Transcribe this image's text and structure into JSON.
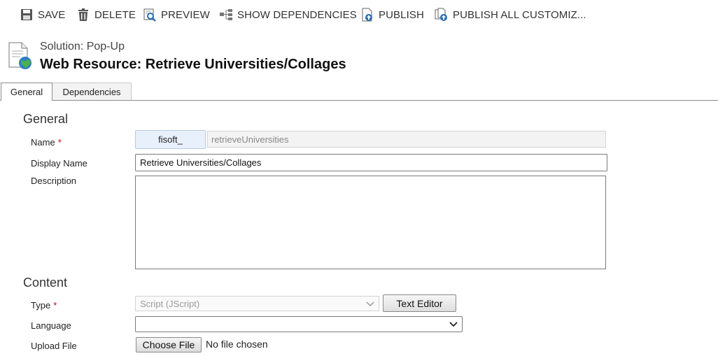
{
  "toolbar": {
    "save": "SAVE",
    "delete": "DELETE",
    "preview": "PREVIEW",
    "show_dependencies": "SHOW DEPENDENCIES",
    "publish": "PUBLISH",
    "publish_all": "PUBLISH ALL CUSTOMIZ..."
  },
  "header": {
    "solution": "Solution: Pop-Up",
    "title": "Web Resource: Retrieve Universities/Collages"
  },
  "tabs": [
    {
      "label": "General",
      "active": true
    },
    {
      "label": "Dependencies",
      "active": false
    }
  ],
  "general": {
    "section_title": "General",
    "name_label": "Name",
    "name_prefix": "fisoft_",
    "name_value": "retrieveUniversities",
    "display_name_label": "Display Name",
    "display_name_value": "Retrieve Universities/Collages",
    "description_label": "Description",
    "description_value": ""
  },
  "content": {
    "section_title": "Content",
    "type_label": "Type",
    "type_value": "Script (JScript)",
    "text_editor_button": "Text Editor",
    "language_label": "Language",
    "language_value": "",
    "upload_label": "Upload File",
    "choose_file_button": "Choose File",
    "no_file_text": "No file chosen"
  },
  "required_marker": "*",
  "colors": {
    "required": "#d00000",
    "prefix_bg": "#e8f1fb"
  }
}
